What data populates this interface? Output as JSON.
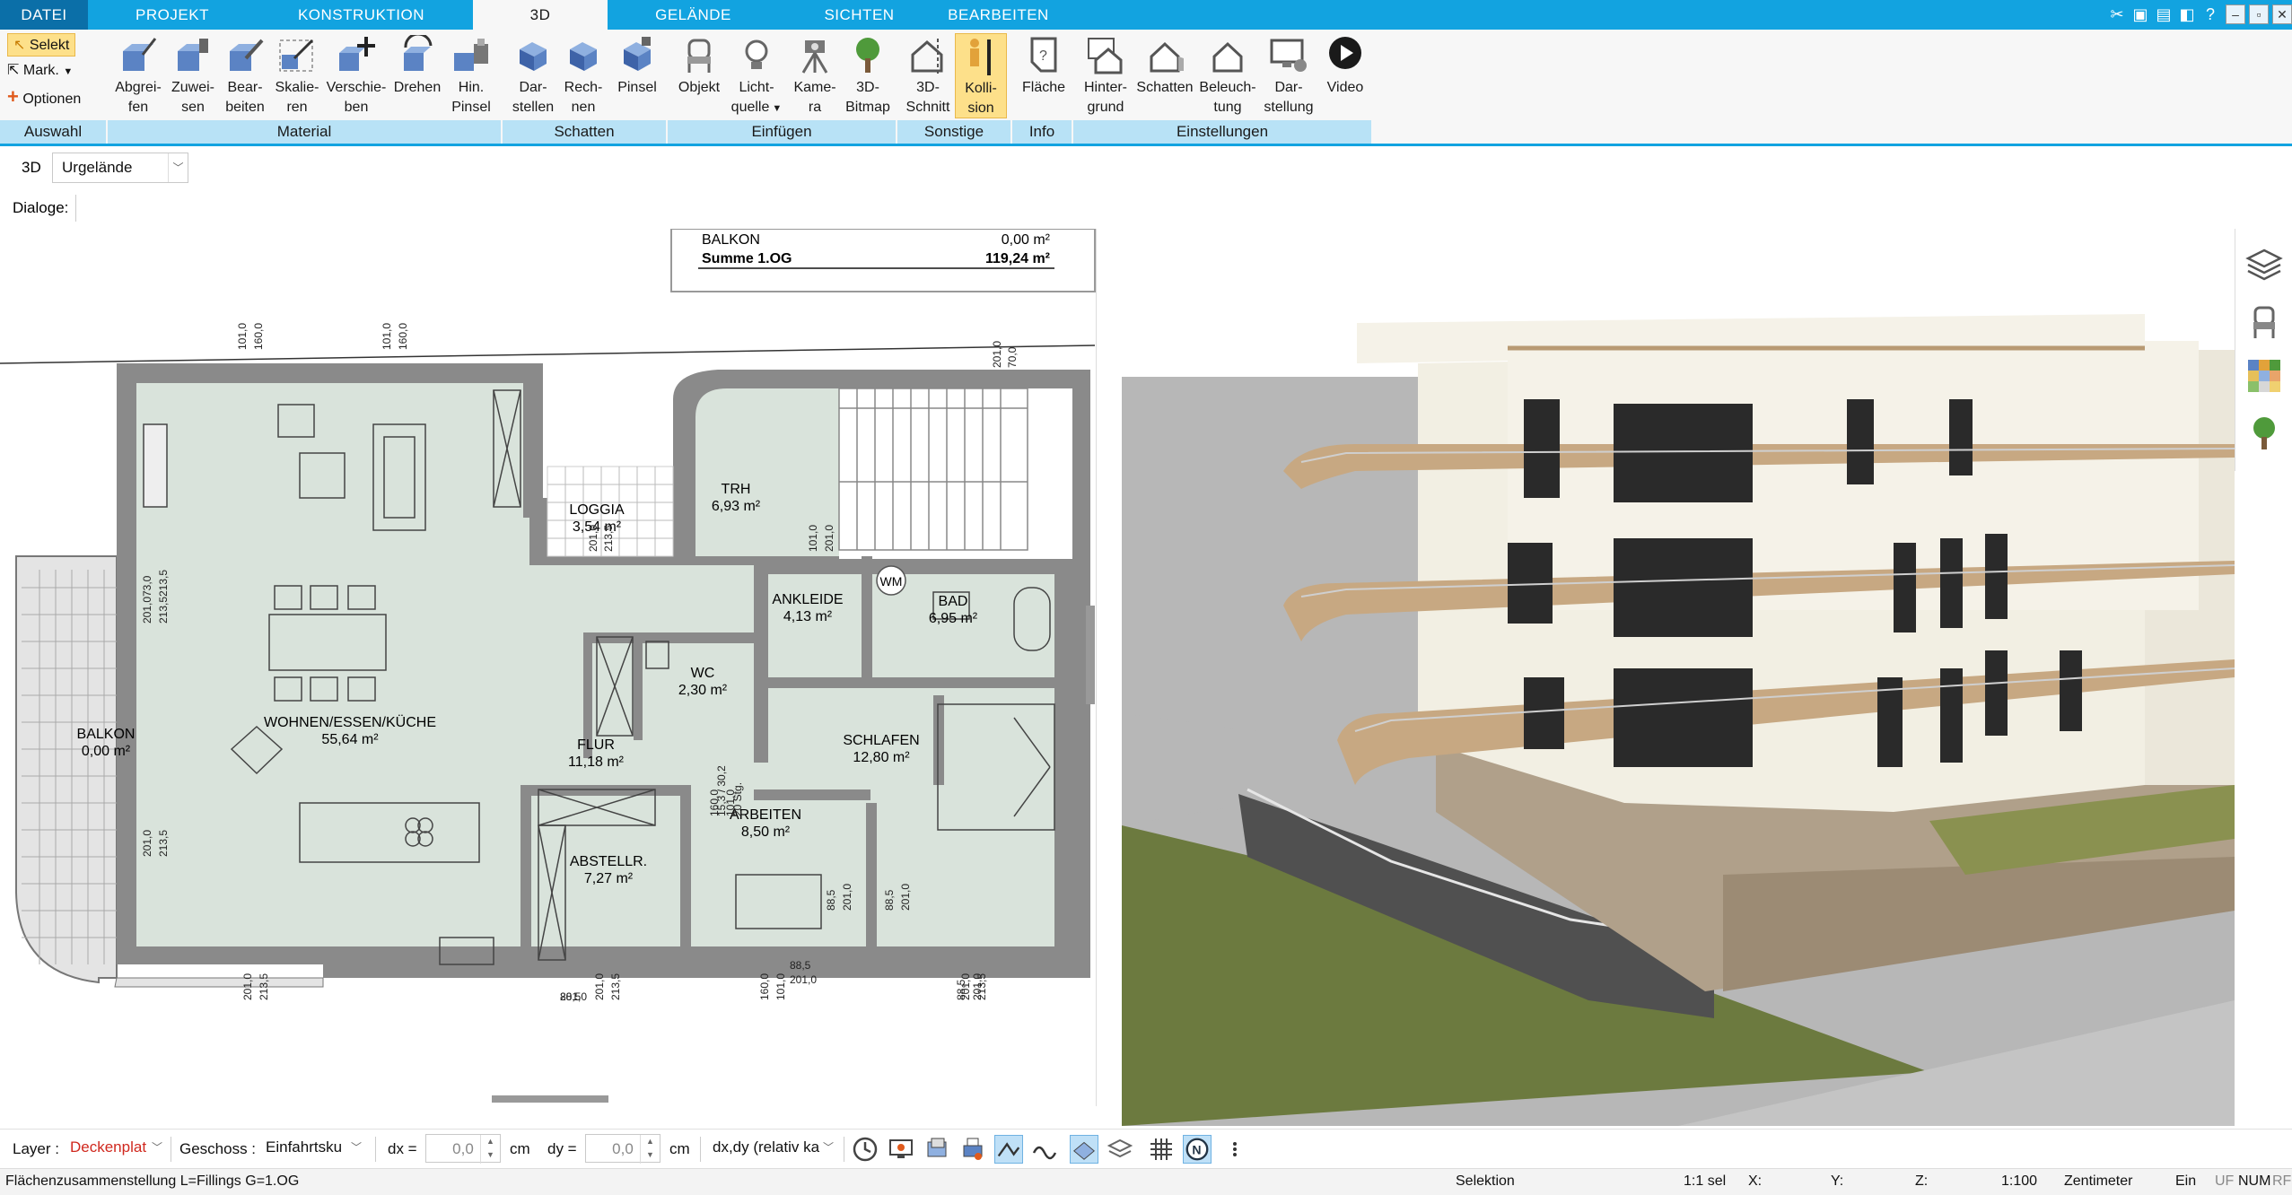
{
  "ribbon": {
    "tabs": [
      "DATEI",
      "PROJEKT",
      "KONSTRUKTION",
      "3D",
      "GELÄNDE",
      "SICHTEN",
      "BEARBEITEN"
    ],
    "active_tab": "3D",
    "auswahl": {
      "selekt": "Selekt",
      "mark": "Mark.",
      "optionen": "Optionen",
      "label": "Auswahl"
    },
    "groups": {
      "material": "Material",
      "schatten": "Schatten",
      "einfuegen": "Einfügen",
      "sonstige": "Sonstige",
      "info": "Info",
      "einstellungen": "Einstellungen"
    },
    "buttons": {
      "abgreifen": [
        "Abgrei-",
        "fen"
      ],
      "zuweisen": [
        "Zuwei-",
        "sen"
      ],
      "bearbeiten": [
        "Bear-",
        "beiten"
      ],
      "skalieren": [
        "Skalie-",
        "ren"
      ],
      "verschieben": [
        "Verschie-",
        "ben"
      ],
      "drehen": [
        "Drehen",
        ""
      ],
      "hin_pinsel": [
        "Hin.",
        "Pinsel"
      ],
      "darstellen": [
        "Dar-",
        "stellen"
      ],
      "rechnen": [
        "Rech-",
        "nen"
      ],
      "pinsel": [
        "Pinsel",
        ""
      ],
      "objekt": [
        "Objekt",
        ""
      ],
      "lichtquelle": [
        "Licht-",
        "quelle"
      ],
      "kamera": [
        "Kame-",
        "ra"
      ],
      "bitmap3d": [
        "3D-",
        "Bitmap"
      ],
      "schnitt3d": [
        "3D-",
        "Schnitt"
      ],
      "kollision": [
        "Kolli-",
        "sion"
      ],
      "flaeche": [
        "Fläche",
        ""
      ],
      "hintergrund": [
        "Hinter-",
        "grund"
      ],
      "schatten": [
        "Schatten",
        ""
      ],
      "beleuchtung": [
        "Beleuch-",
        "tung"
      ],
      "darstellung": [
        "Dar-",
        "stellung"
      ],
      "video": [
        "Video",
        ""
      ]
    }
  },
  "view_row": {
    "mode": "3D",
    "terrain": "Urgelände"
  },
  "dialog_row": {
    "label": "Dialoge:"
  },
  "plan": {
    "area_table": [
      {
        "name": "BALKON",
        "value": "0,00  m²"
      },
      {
        "name": "Summe 1.OG",
        "value": "119,24 m²"
      }
    ],
    "rooms": [
      {
        "name": "TRH",
        "area": "6,93 m²"
      },
      {
        "name": "LOGGIA",
        "area": "3,54 m²"
      },
      {
        "name": "ANKLEIDE",
        "area": "4,13 m²"
      },
      {
        "name": "BAD",
        "area": "6,95 m²"
      },
      {
        "name": "WC",
        "area": "2,30 m²"
      },
      {
        "name": "WOHNEN/ESSEN/KÜCHE",
        "area": "55,64 m²"
      },
      {
        "name": "BALKON",
        "area": "0,00 m²"
      },
      {
        "name": "FLUR",
        "area": "11,18 m²"
      },
      {
        "name": "SCHLAFEN",
        "area": "12,80 m²"
      },
      {
        "name": "ARBEITEN",
        "area": "8,50 m²"
      },
      {
        "name": "ABSTELLR.",
        "area": "7,27 m²"
      }
    ],
    "dims": [
      "101,0",
      "160,0",
      "101,0",
      "160,0",
      "201,0",
      "70,0",
      "73,0",
      "213,5",
      "201,0",
      "213,5",
      "201,0",
      "213,5",
      "201,0",
      "213,5",
      "201,0",
      "213,5",
      "101,0",
      "201,0",
      "15,3 / 30,2",
      "20 Stg.",
      "88,5",
      "201,0",
      "88,5",
      "201,0",
      "88,5",
      "201,0",
      "88,5",
      "201,0",
      "88,5",
      "201,0",
      "201,0",
      "213,5",
      "160,0",
      "101,0",
      "160,0",
      "101,0",
      "201,0",
      "213,5"
    ],
    "wm": "WM"
  },
  "bottom": {
    "layer_label": "Layer :",
    "layer_value": "Deckenplat",
    "geschoss_label": "Geschoss :",
    "geschoss_value": "Einfahrtsku",
    "dx_label": "dx =",
    "dx_value": "0,0",
    "dy_label": "dy =",
    "dy_value": "0,0",
    "unit1": "cm",
    "unit2": "cm",
    "mode_value": "dx,dy (relativ ka"
  },
  "status": {
    "left": "Flächenzusammenstellung L=Fillings G=1.OG",
    "selektion": "Selektion",
    "sel": "1:1 sel",
    "x": "X:",
    "y": "Y:",
    "z": "Z:",
    "scale": "1:100",
    "unit": "Zentimeter",
    "ein": "Ein",
    "uf": "UF",
    "num": "NUM",
    "rf": "RF"
  },
  "colors": {
    "accent": "#12a3e0",
    "group_label": "#b8e2f6",
    "active_button": "#fde08a",
    "room_fill": "#d9e3db",
    "wall": "#8a8a8a",
    "facade": "#f2efe3",
    "grass": "#5a6b3a",
    "sky": "#ffffff"
  }
}
